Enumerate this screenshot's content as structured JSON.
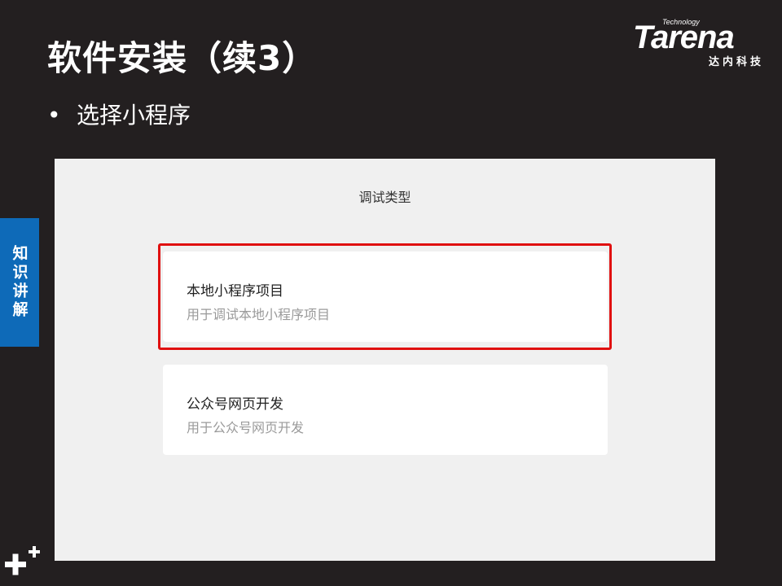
{
  "slide": {
    "title": "软件安装（续3）",
    "bullet": "选择小程序"
  },
  "logo": {
    "tech": "Technology",
    "word": "Tarena",
    "cn": "达内科技"
  },
  "side_tab": {
    "label": "知识讲解"
  },
  "dialog": {
    "title": "调试类型",
    "options": [
      {
        "title": "本地小程序项目",
        "description": "用于调试本地小程序项目"
      },
      {
        "title": "公众号网页开发",
        "description": "用于公众号网页开发"
      }
    ]
  },
  "colors": {
    "background": "#231f20",
    "side_tab": "#0e6ab8",
    "highlight": "#e01010",
    "panel": "#f0f0f0"
  },
  "icons": {
    "corner": "plus-icon"
  }
}
